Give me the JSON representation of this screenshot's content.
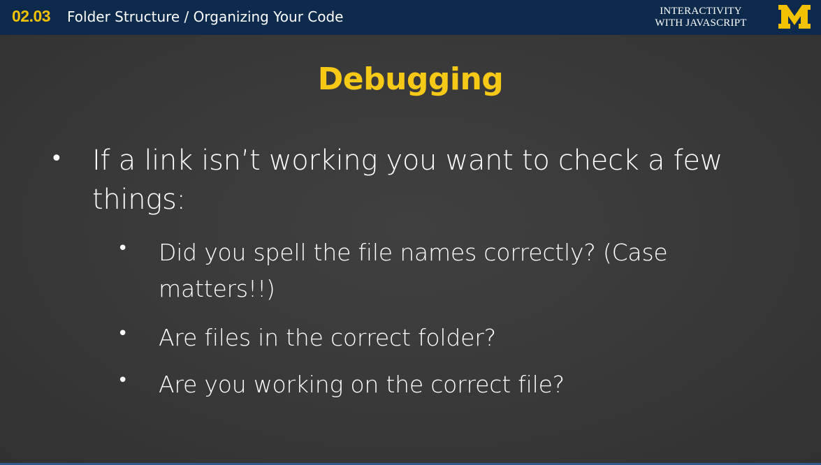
{
  "header": {
    "lesson_number": "02.03",
    "lesson_title": "Folder Structure / Organizing Your Code",
    "course_line1": "INTERACTIVITY",
    "course_line2": "WITH JAVASCRIPT",
    "logo_letter": "M",
    "colors": {
      "bar": "#0d2a4d",
      "accent": "#f2c200"
    }
  },
  "slide": {
    "title": "Debugging",
    "title_color": "#f6c916",
    "bullets": [
      {
        "text": "If a link isn’t working you want to check a few things:",
        "sub_bullets": [
          "Did you spell the file names correctly? (Case matters!!)",
          "Are files in the correct folder?",
          "Are you working on the correct file?"
        ]
      }
    ],
    "bullet_glyph": "•"
  }
}
